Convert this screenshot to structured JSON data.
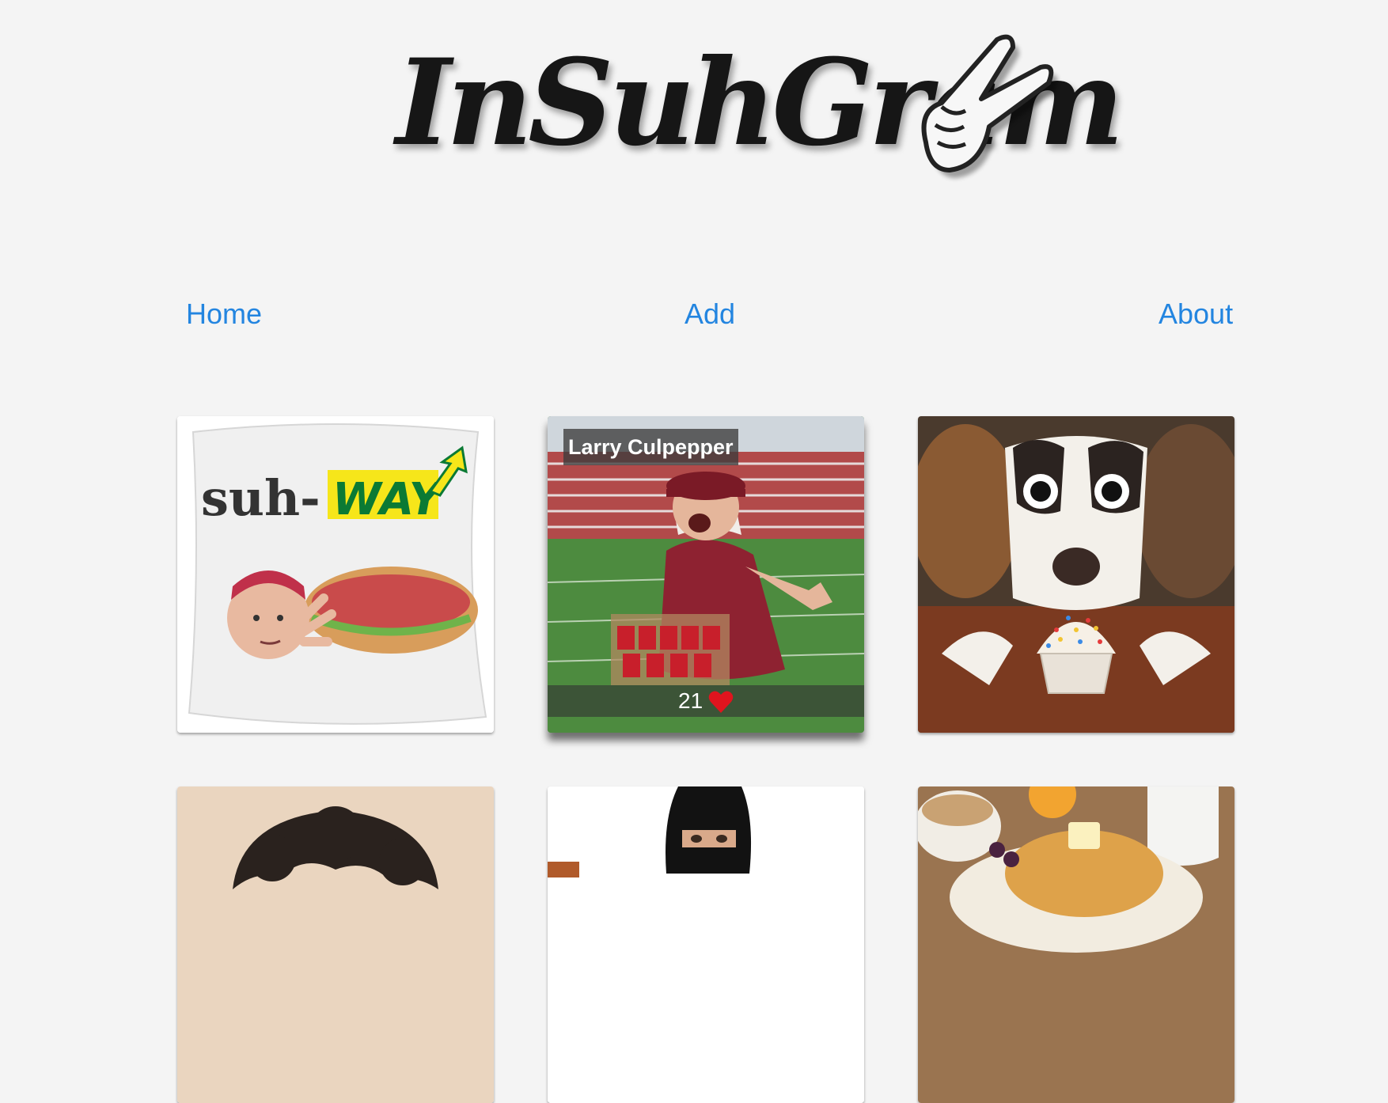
{
  "logo": {
    "text": "InSuhGram",
    "icon": "peace-sign-hand-icon"
  },
  "nav": {
    "home": "Home",
    "add": "Add",
    "about": "About"
  },
  "cards": [
    {
      "image": "suh-way pillow with face and sandwich",
      "pillow_text_left": "suh-",
      "pillow_text_right": "WAY"
    },
    {
      "image": "man yelling in football stadium holding cup tray",
      "caption": "Larry Culpepper",
      "likes": "21",
      "like_icon": "heart-icon"
    },
    {
      "image": "puppy sniffing sprinkled cupcake"
    },
    {
      "image": "curly haired person"
    },
    {
      "image": "person in black ski mask"
    },
    {
      "image": "breakfast table with pancakes"
    }
  ],
  "colors": {
    "background": "#f4f4f4",
    "nav_link": "#2385e0",
    "heart": "#e0141e"
  }
}
